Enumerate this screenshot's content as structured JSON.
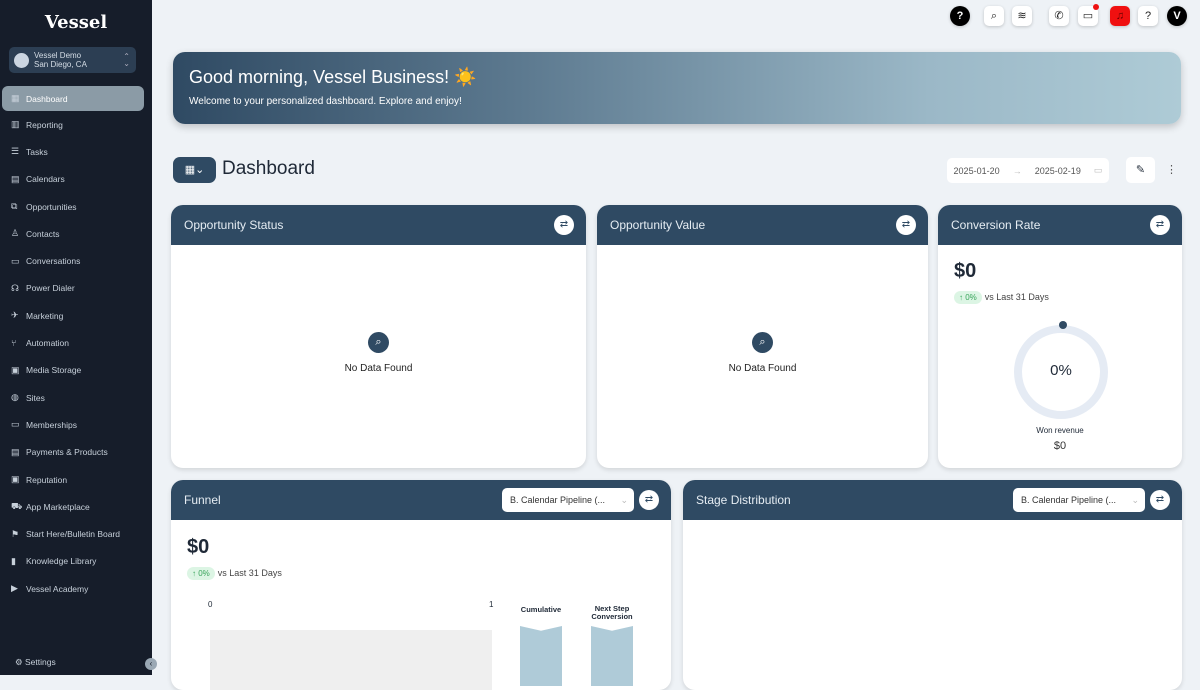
{
  "sidebar": {
    "logo": "Vessel",
    "account": {
      "name": "Vessel Demo",
      "location": "San Diego, CA"
    },
    "items": [
      {
        "label": "Dashboard",
        "icon": "▦"
      },
      {
        "label": "Reporting",
        "icon": "▥"
      },
      {
        "label": "Tasks",
        "icon": "☰"
      },
      {
        "label": "Calendars",
        "icon": "▤"
      },
      {
        "label": "Opportunities",
        "icon": "⧉"
      },
      {
        "label": "Contacts",
        "icon": "♙"
      },
      {
        "label": "Conversations",
        "icon": "▭"
      },
      {
        "label": "Power Dialer",
        "icon": "☊"
      },
      {
        "label": "Marketing",
        "icon": "✈"
      },
      {
        "label": "Automation",
        "icon": "⑂"
      },
      {
        "label": "Media Storage",
        "icon": "▣"
      },
      {
        "label": "Sites",
        "icon": "◍"
      },
      {
        "label": "Memberships",
        "icon": "▭"
      },
      {
        "label": "Payments & Products",
        "icon": "▤"
      },
      {
        "label": "Reputation",
        "icon": "▣"
      },
      {
        "label": "App Marketplace",
        "icon": "⛟"
      },
      {
        "label": "Start Here/Bulletin Board",
        "icon": "⚑"
      },
      {
        "label": "Knowledge Library",
        "icon": "▮"
      },
      {
        "label": "Vessel Academy",
        "icon": "▶"
      }
    ],
    "settings": "Settings"
  },
  "banner": {
    "title": "Good morning, Vessel Business! ☀️",
    "subtitle": "Welcome to your personalized dashboard. Explore and enjoy!"
  },
  "dashboard": {
    "title": "Dashboard",
    "date_from": "2025-01-20",
    "date_to": "2025-02-19"
  },
  "cards": {
    "opp_status": {
      "title": "Opportunity Status",
      "empty": "No Data Found"
    },
    "opp_value": {
      "title": "Opportunity Value",
      "empty": "No Data Found"
    },
    "conversion": {
      "title": "Conversion Rate",
      "value": "$0",
      "change": "↑ 0%",
      "compare": "vs Last 31 Days",
      "percent": "0%",
      "won_label": "Won revenue",
      "won_value": "$0"
    },
    "funnel": {
      "title": "Funnel",
      "pipeline": "B. Calendar Pipeline (...",
      "value": "$0",
      "change": "↑ 0%",
      "compare": "vs Last 31 Days",
      "axis_min": "0",
      "axis_max": "1",
      "col1": "Cumulative",
      "col2": "Next Step Conversion"
    },
    "stage": {
      "title": "Stage Distribution",
      "pipeline": "B. Calendar Pipeline (..."
    }
  }
}
